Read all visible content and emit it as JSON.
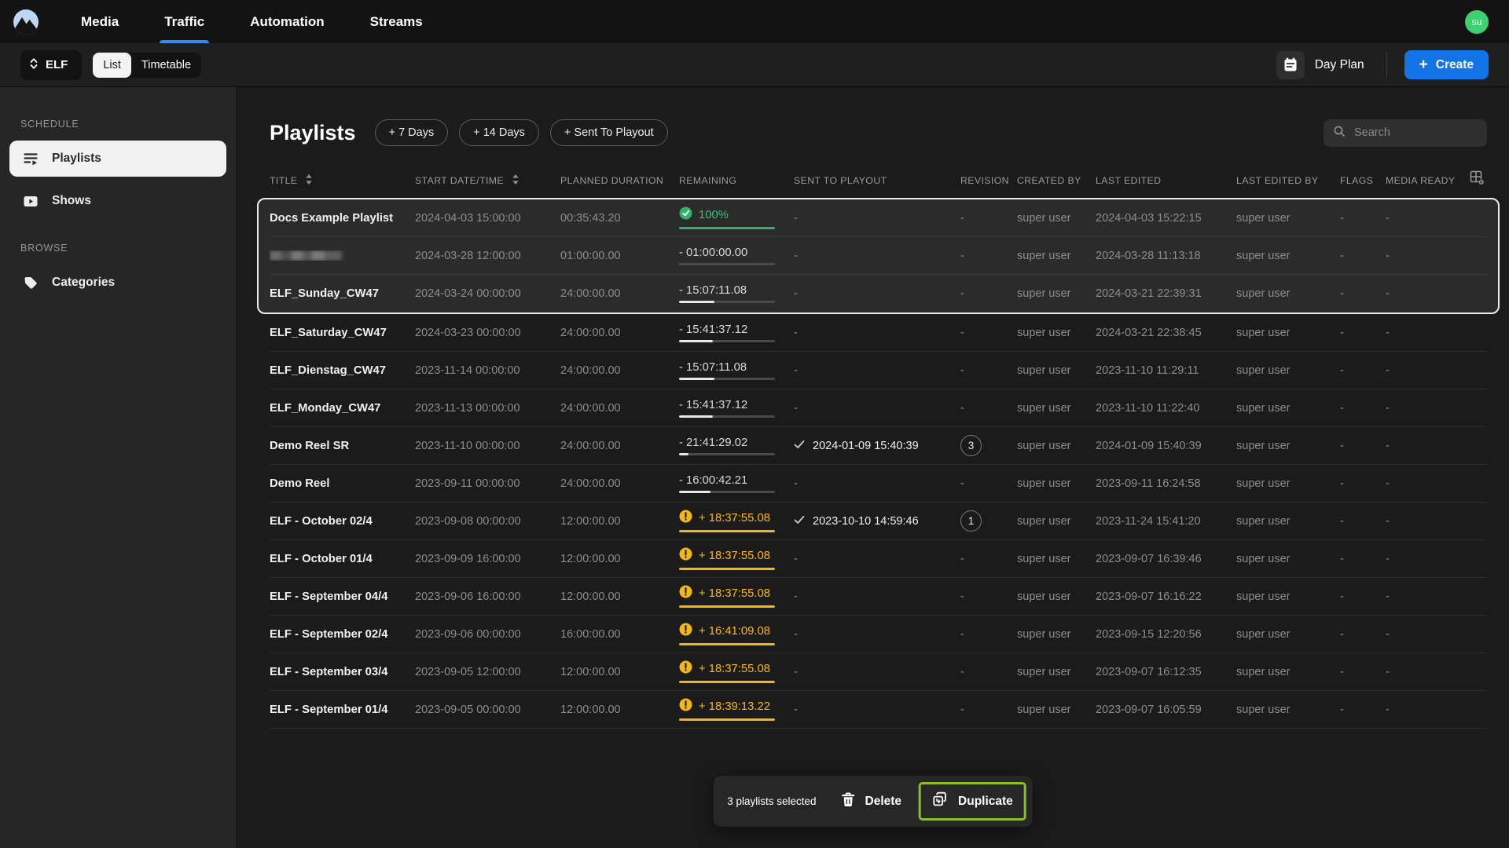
{
  "topnav": {
    "items": [
      {
        "label": "Media",
        "active": false
      },
      {
        "label": "Traffic",
        "active": true
      },
      {
        "label": "Automation",
        "active": false
      },
      {
        "label": "Streams",
        "active": false
      }
    ],
    "avatar": "su"
  },
  "toolbar": {
    "channel": "ELF",
    "view_toggle": [
      {
        "label": "List",
        "active": true
      },
      {
        "label": "Timetable",
        "active": false
      }
    ],
    "day_plan_label": "Day Plan",
    "create_plus": "+",
    "create_label": "Create"
  },
  "sidebar": {
    "sections": [
      {
        "heading": "SCHEDULE",
        "items": [
          {
            "label": "Playlists",
            "icon": "playlist-icon",
            "active": true
          },
          {
            "label": "Shows",
            "icon": "shows-icon",
            "active": false
          }
        ]
      },
      {
        "heading": "BROWSE",
        "items": [
          {
            "label": "Categories",
            "icon": "categories-icon",
            "active": false
          }
        ]
      }
    ]
  },
  "main": {
    "title": "Playlists",
    "quick_buttons": [
      "+ 7 Days",
      "+ 14 Days",
      "+ Sent To Playout"
    ],
    "search_placeholder": "Search"
  },
  "table": {
    "columns": [
      {
        "label": "TITLE",
        "sortable": true
      },
      {
        "label": "START DATE/TIME",
        "sortable": true
      },
      {
        "label": "PLANNED DURATION",
        "sortable": false
      },
      {
        "label": "REMAINING",
        "sortable": false
      },
      {
        "label": "SENT TO PLAYOUT",
        "sortable": false
      },
      {
        "label": "REVISION",
        "sortable": false
      },
      {
        "label": "CREATED BY",
        "sortable": false
      },
      {
        "label": "LAST EDITED",
        "sortable": false
      },
      {
        "label": "LAST EDITED BY",
        "sortable": false
      },
      {
        "label": "FLAGS",
        "sortable": false
      },
      {
        "label": "MEDIA READY",
        "sortable": false
      }
    ],
    "rows": [
      {
        "title": "Docs Example Playlist",
        "redacted": false,
        "selected": true,
        "start": "2024-04-03 15:00:00",
        "planned": "00:35:43.20",
        "remaining": {
          "status": "complete",
          "text": "100%",
          "progress": 100
        },
        "sent_to_playout": "-",
        "revision": "-",
        "created_by": "super user",
        "last_edited": "2024-04-03 15:22:15",
        "last_edited_by": "super user",
        "flags": "-",
        "media_ready": "-"
      },
      {
        "title": "",
        "redacted": true,
        "selected": true,
        "start": "2024-03-28 12:00:00",
        "planned": "01:00:00.00",
        "remaining": {
          "status": "neutral",
          "text": "- 01:00:00.00",
          "progress": 0
        },
        "sent_to_playout": "-",
        "revision": "-",
        "created_by": "super user",
        "last_edited": "2024-03-28 11:13:18",
        "last_edited_by": "super user",
        "flags": "-",
        "media_ready": "-"
      },
      {
        "title": "ELF_Sunday_CW47",
        "redacted": false,
        "selected": true,
        "start": "2024-03-24 00:00:00",
        "planned": "24:00:00.00",
        "remaining": {
          "status": "neutral",
          "text": "- 15:07:11.08",
          "progress": 37
        },
        "sent_to_playout": "-",
        "revision": "-",
        "created_by": "super user",
        "last_edited": "2024-03-21 22:39:31",
        "last_edited_by": "super user",
        "flags": "-",
        "media_ready": "-"
      },
      {
        "title": "ELF_Saturday_CW47",
        "redacted": false,
        "selected": false,
        "start": "2024-03-23 00:00:00",
        "planned": "24:00:00.00",
        "remaining": {
          "status": "neutral",
          "text": "- 15:41:37.12",
          "progress": 35
        },
        "sent_to_playout": "-",
        "revision": "-",
        "created_by": "super user",
        "last_edited": "2024-03-21 22:38:45",
        "last_edited_by": "super user",
        "flags": "-",
        "media_ready": "-"
      },
      {
        "title": "ELF_Dienstag_CW47",
        "redacted": false,
        "selected": false,
        "start": "2023-11-14 00:00:00",
        "planned": "24:00:00.00",
        "remaining": {
          "status": "neutral",
          "text": "- 15:07:11.08",
          "progress": 37
        },
        "sent_to_playout": "-",
        "revision": "-",
        "created_by": "super user",
        "last_edited": "2023-11-10 11:29:11",
        "last_edited_by": "super user",
        "flags": "-",
        "media_ready": "-"
      },
      {
        "title": "ELF_Monday_CW47",
        "redacted": false,
        "selected": false,
        "start": "2023-11-13 00:00:00",
        "planned": "24:00:00.00",
        "remaining": {
          "status": "neutral",
          "text": "- 15:41:37.12",
          "progress": 35
        },
        "sent_to_playout": "-",
        "revision": "-",
        "created_by": "super user",
        "last_edited": "2023-11-10 11:22:40",
        "last_edited_by": "super user",
        "flags": "-",
        "media_ready": "-"
      },
      {
        "title": "Demo Reel SR",
        "redacted": false,
        "selected": false,
        "start": "2023-11-10 00:00:00",
        "planned": "24:00:00.00",
        "remaining": {
          "status": "neutral",
          "text": "- 21:41:29.02",
          "progress": 10
        },
        "sent_to_playout": "2024-01-09 15:40:39",
        "revision": "3",
        "created_by": "super user",
        "last_edited": "2024-01-09 15:40:39",
        "last_edited_by": "super user",
        "flags": "-",
        "media_ready": "-"
      },
      {
        "title": "Demo Reel",
        "redacted": false,
        "selected": false,
        "start": "2023-09-11 00:00:00",
        "planned": "24:00:00.00",
        "remaining": {
          "status": "neutral",
          "text": "- 16:00:42.21",
          "progress": 33
        },
        "sent_to_playout": "-",
        "revision": "-",
        "created_by": "super user",
        "last_edited": "2023-09-11 16:24:58",
        "last_edited_by": "super user",
        "flags": "-",
        "media_ready": "-"
      },
      {
        "title": "ELF - October 02/4",
        "redacted": false,
        "selected": false,
        "start": "2023-09-08 00:00:00",
        "planned": "12:00:00.00",
        "remaining": {
          "status": "warning",
          "text": "+ 18:37:55.08",
          "progress": 100
        },
        "sent_to_playout": "2023-10-10 14:59:46",
        "revision": "1",
        "created_by": "super user",
        "last_edited": "2023-11-24 15:41:20",
        "last_edited_by": "super user",
        "flags": "-",
        "media_ready": "-"
      },
      {
        "title": "ELF - October 01/4",
        "redacted": false,
        "selected": false,
        "start": "2023-09-09 16:00:00",
        "planned": "12:00:00.00",
        "remaining": {
          "status": "warning",
          "text": "+ 18:37:55.08",
          "progress": 100
        },
        "sent_to_playout": "-",
        "revision": "-",
        "created_by": "super user",
        "last_edited": "2023-09-07 16:39:46",
        "last_edited_by": "super user",
        "flags": "-",
        "media_ready": "-"
      },
      {
        "title": "ELF - September 04/4",
        "redacted": false,
        "selected": false,
        "start": "2023-09-06 16:00:00",
        "planned": "12:00:00.00",
        "remaining": {
          "status": "warning",
          "text": "+ 18:37:55.08",
          "progress": 100
        },
        "sent_to_playout": "-",
        "revision": "-",
        "created_by": "super user",
        "last_edited": "2023-09-07 16:16:22",
        "last_edited_by": "super user",
        "flags": "-",
        "media_ready": "-"
      },
      {
        "title": "ELF - September 02/4",
        "redacted": false,
        "selected": false,
        "start": "2023-09-06 00:00:00",
        "planned": "16:00:00.00",
        "remaining": {
          "status": "warning",
          "text": "+ 16:41:09.08",
          "progress": 100
        },
        "sent_to_playout": "-",
        "revision": "-",
        "created_by": "super user",
        "last_edited": "2023-09-15 12:20:56",
        "last_edited_by": "super user",
        "flags": "-",
        "media_ready": "-"
      },
      {
        "title": "ELF - September 03/4",
        "redacted": false,
        "selected": false,
        "start": "2023-09-05 12:00:00",
        "planned": "12:00:00.00",
        "remaining": {
          "status": "warning",
          "text": "+ 18:37:55.08",
          "progress": 100
        },
        "sent_to_playout": "-",
        "revision": "-",
        "created_by": "super user",
        "last_edited": "2023-09-07 16:12:35",
        "last_edited_by": "super user",
        "flags": "-",
        "media_ready": "-"
      },
      {
        "title": "ELF - September 01/4",
        "redacted": false,
        "selected": false,
        "start": "2023-09-05 00:00:00",
        "planned": "12:00:00.00",
        "remaining": {
          "status": "warning",
          "text": "+ 18:39:13.22",
          "progress": 100
        },
        "sent_to_playout": "-",
        "revision": "-",
        "created_by": "super user",
        "last_edited": "2023-09-07 16:05:59",
        "last_edited_by": "super user",
        "flags": "-",
        "media_ready": "-"
      }
    ]
  },
  "selection_bar": {
    "text": "3 playlists selected",
    "delete_label": "Delete",
    "duplicate_label": "Duplicate"
  },
  "colors": {
    "accent_blue": "#2d8cf0",
    "create_blue": "#1274e7",
    "success_green": "#2fb269",
    "warning_yellow": "#f5b515",
    "highlight_green": "#8bbf26",
    "avatar_green": "#3ed070",
    "selected_border": "#ececec"
  }
}
